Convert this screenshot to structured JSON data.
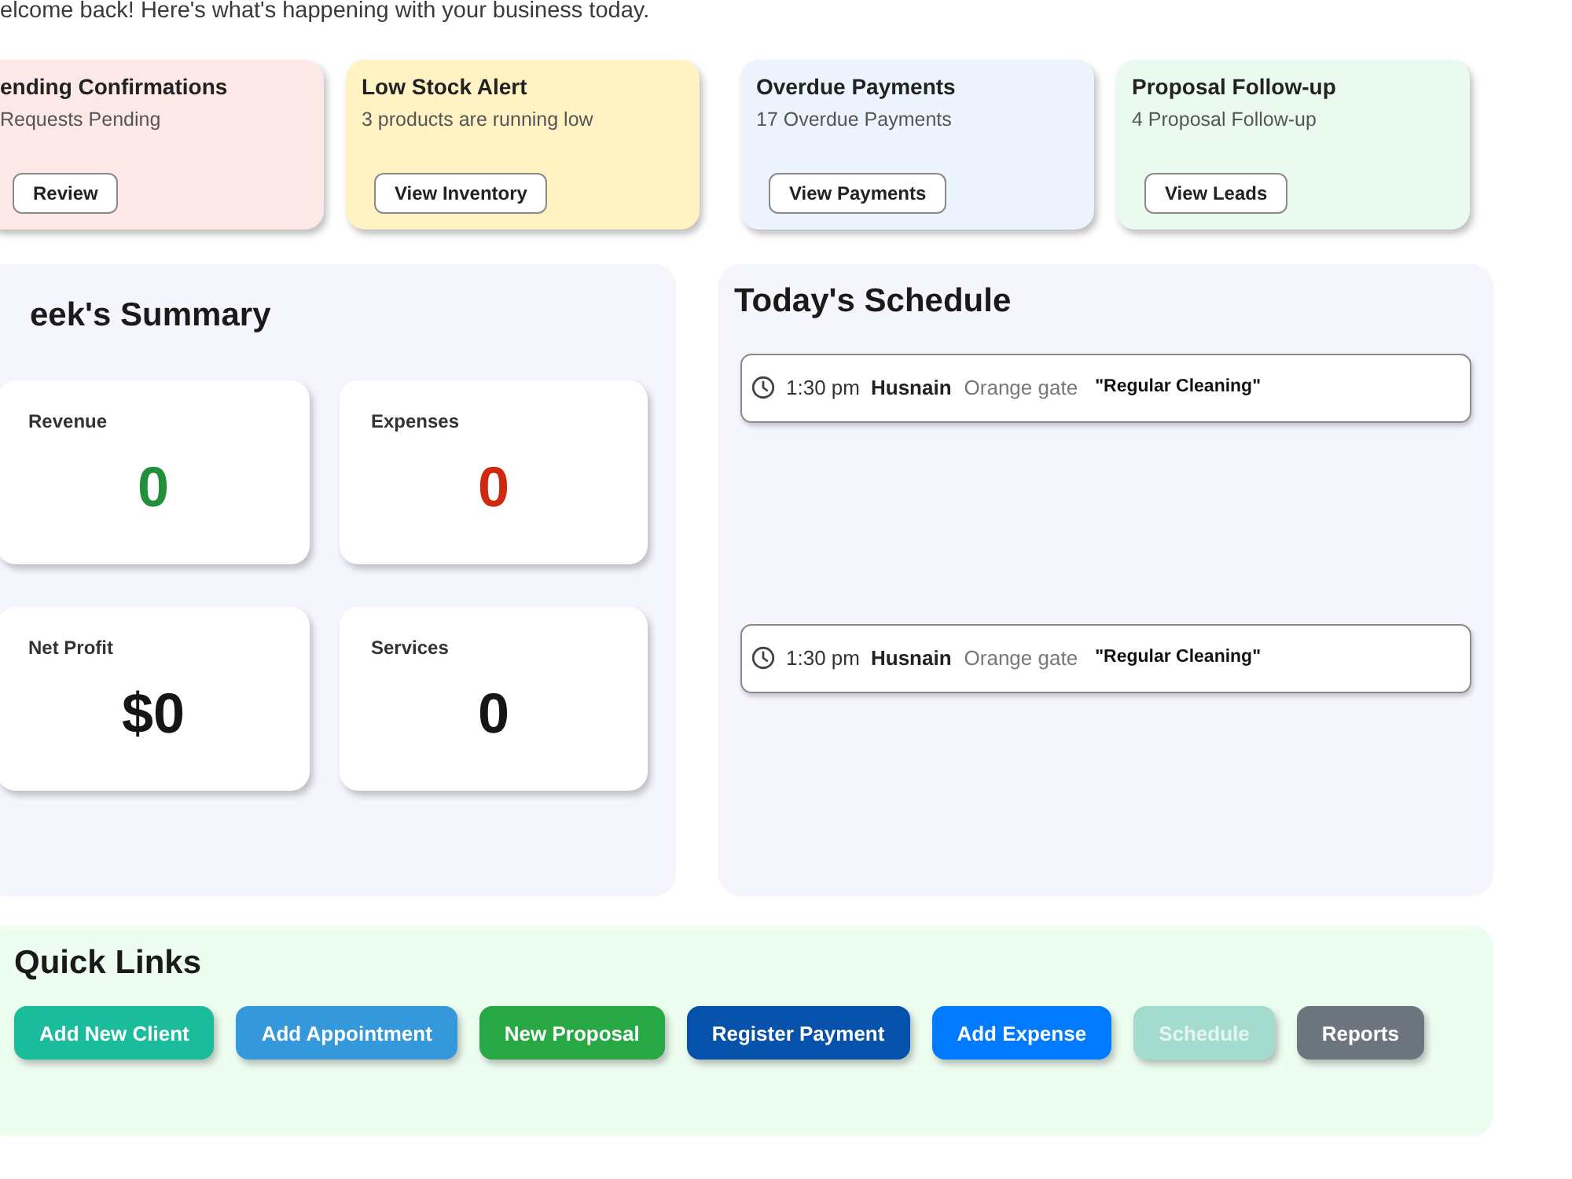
{
  "welcome": {
    "text": "elcome back! Here's what's happening with your business today."
  },
  "alert_cards": [
    {
      "title": "ending Confirmations",
      "subtitle": "Requests Pending",
      "button": "Review",
      "color": "#fde8e8"
    },
    {
      "title": "Low Stock Alert",
      "subtitle": "3 products are running low",
      "button": "View Inventory",
      "color": "#fff3c4"
    },
    {
      "title": "Overdue Payments",
      "subtitle": "17 Overdue Payments",
      "button": "View Payments",
      "color": "#edf4fd"
    },
    {
      "title": "Proposal Follow-up",
      "subtitle": "4 Proposal Follow-up",
      "button": "View Leads",
      "color": "#ebfaef"
    }
  ],
  "summary": {
    "title": "eek's Summary",
    "stats": [
      {
        "label": "Revenue",
        "value": "0",
        "color": "#22903a"
      },
      {
        "label": "Expenses",
        "value": "0",
        "color": "#cf2a10"
      },
      {
        "label": "Net Profit",
        "value": "$0",
        "color": "#151515"
      },
      {
        "label": "Services",
        "value": "0",
        "color": "#151515"
      }
    ]
  },
  "schedule": {
    "title": "Today's Schedule",
    "appointments": [
      {
        "time": "1:30 pm",
        "client": "Husnain",
        "location": "Orange gate",
        "service": "\"Regular Cleaning\""
      },
      {
        "time": "1:30 pm",
        "client": "Husnain",
        "location": "Orange gate",
        "service": "\"Regular Cleaning\""
      }
    ]
  },
  "quick_links": {
    "title": "Quick Links",
    "buttons": [
      {
        "label": "Add New Client",
        "color": "#1abc9c",
        "disabled": false
      },
      {
        "label": "Add Appointment",
        "color": "#3498db",
        "disabled": false
      },
      {
        "label": "New Proposal",
        "color": "#28a745",
        "disabled": false
      },
      {
        "label": "Register Payment",
        "color": "#0652aa",
        "disabled": false
      },
      {
        "label": "Add Expense",
        "color": "#007bff",
        "disabled": false
      },
      {
        "label": "Schedule",
        "color": "#a3dccf",
        "disabled": true
      },
      {
        "label": "Reports",
        "color": "#6c757d",
        "disabled": false
      }
    ]
  }
}
